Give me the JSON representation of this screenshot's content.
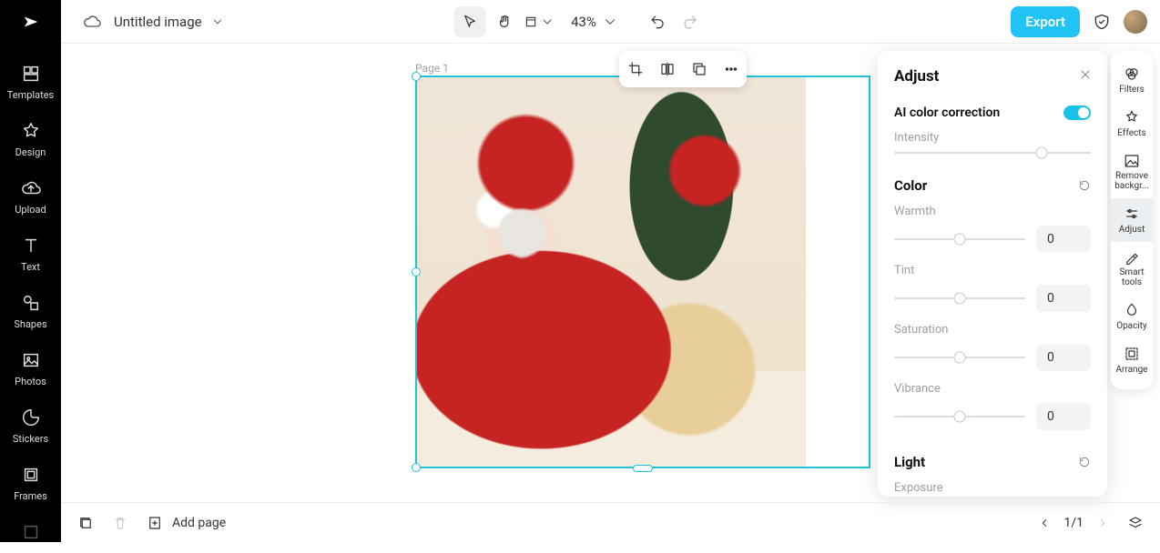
{
  "app": {
    "title": "Untitled image"
  },
  "topbar": {
    "zoom": "43%",
    "export": "Export"
  },
  "left_rail": {
    "items": [
      {
        "label": "Templates"
      },
      {
        "label": "Design"
      },
      {
        "label": "Upload"
      },
      {
        "label": "Text"
      },
      {
        "label": "Shapes"
      },
      {
        "label": "Photos"
      },
      {
        "label": "Stickers"
      },
      {
        "label": "Frames"
      }
    ]
  },
  "canvas": {
    "page_label": "Page 1"
  },
  "adjust": {
    "title": "Adjust",
    "ai_label": "AI color correction",
    "ai_on": true,
    "intensity_label": "Intensity",
    "color_section": "Color",
    "sliders": [
      {
        "label": "Warmth",
        "value": "0"
      },
      {
        "label": "Tint",
        "value": "0"
      },
      {
        "label": "Saturation",
        "value": "0"
      },
      {
        "label": "Vibrance",
        "value": "0"
      }
    ],
    "light_section": "Light",
    "exposure_label": "Exposure"
  },
  "right_rail": {
    "items": [
      {
        "label": "Filters"
      },
      {
        "label": "Effects"
      },
      {
        "label": "Remove backgr..."
      },
      {
        "label": "Adjust"
      },
      {
        "label": "Smart tools"
      },
      {
        "label": "Opacity"
      },
      {
        "label": "Arrange"
      }
    ]
  },
  "bottom": {
    "add_page": "Add page",
    "page_indicator": "1/1"
  },
  "colors": {
    "accent": "#20c4f4",
    "selection": "#1fc3d8"
  }
}
